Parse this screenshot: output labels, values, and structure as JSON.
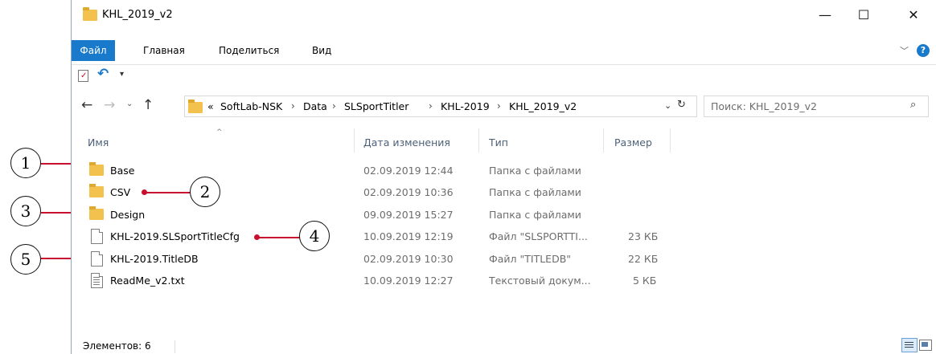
{
  "window": {
    "title": "KHL_2019_v2",
    "controls": {
      "minimize": "—",
      "maximize": "☐",
      "close": "✕"
    }
  },
  "ribbon": {
    "tabs": [
      "Файл",
      "Главная",
      "Поделиться",
      "Вид"
    ],
    "help": "?"
  },
  "address": {
    "overflow": "«",
    "crumbs": [
      "SoftLab-NSK",
      "Data",
      "SLSportTitler",
      "KHL-2019",
      "KHL_2019_v2"
    ],
    "search_placeholder": "Поиск: KHL_2019_v2"
  },
  "columns": {
    "name": "Имя",
    "date": "Дата изменения",
    "type": "Тип",
    "size": "Размер"
  },
  "files": [
    {
      "name": "Base",
      "date": "02.09.2019 12:44",
      "type": "Папка с файлами",
      "size": "",
      "icon": "folder-icon"
    },
    {
      "name": "CSV",
      "date": "02.09.2019 10:36",
      "type": "Папка с файлами",
      "size": "",
      "icon": "folder-icon"
    },
    {
      "name": "Design",
      "date": "09.09.2019 15:27",
      "type": "Папка с файлами",
      "size": "",
      "icon": "folder-icon"
    },
    {
      "name": "KHL-2019.SLSportTitleCfg",
      "date": "10.09.2019 12:19",
      "type": "Файл \"SLSPORTTI...",
      "size": "23 КБ",
      "icon": "file-icon"
    },
    {
      "name": "KHL-2019.TitleDB",
      "date": "02.09.2019 10:30",
      "type": "Файл \"TITLEDB\"",
      "size": "22 КБ",
      "icon": "file-icon"
    },
    {
      "name": "ReadMe_v2.txt",
      "date": "10.09.2019 12:27",
      "type": "Текстовый докум...",
      "size": "5 КБ",
      "icon": "text-file-icon"
    }
  ],
  "status": {
    "items": "Элементов: 6"
  },
  "callouts": [
    "1",
    "2",
    "3",
    "4",
    "5"
  ],
  "colors": {
    "accent": "#1979ca",
    "callout_line": "#c8102e",
    "folder": "#f2c14e"
  }
}
